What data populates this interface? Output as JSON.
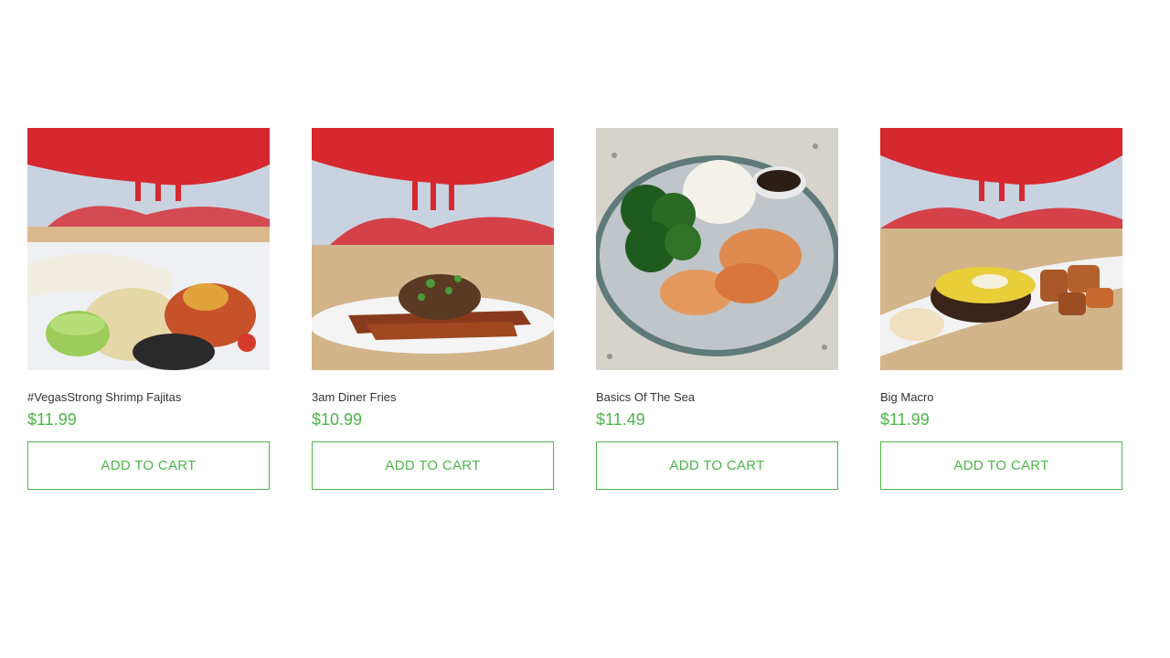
{
  "accent_color": "#4cb648",
  "products": [
    {
      "name": "#VegasStrong Shrimp Fajitas",
      "price": "$11.99",
      "button_label": "ADD TO CART",
      "image": "shrimp-fajitas-plate"
    },
    {
      "name": "3am Diner Fries",
      "price": "$10.99",
      "button_label": "ADD TO CART",
      "image": "loaded-sweet-potato-fries-plate"
    },
    {
      "name": "Basics Of The Sea",
      "price": "$11.49",
      "button_label": "ADD TO CART",
      "image": "shrimp-rice-broccoli-plate"
    },
    {
      "name": "Big Macro",
      "price": "$11.99",
      "button_label": "ADD TO CART",
      "image": "burger-patty-sweet-potato-plate"
    }
  ]
}
